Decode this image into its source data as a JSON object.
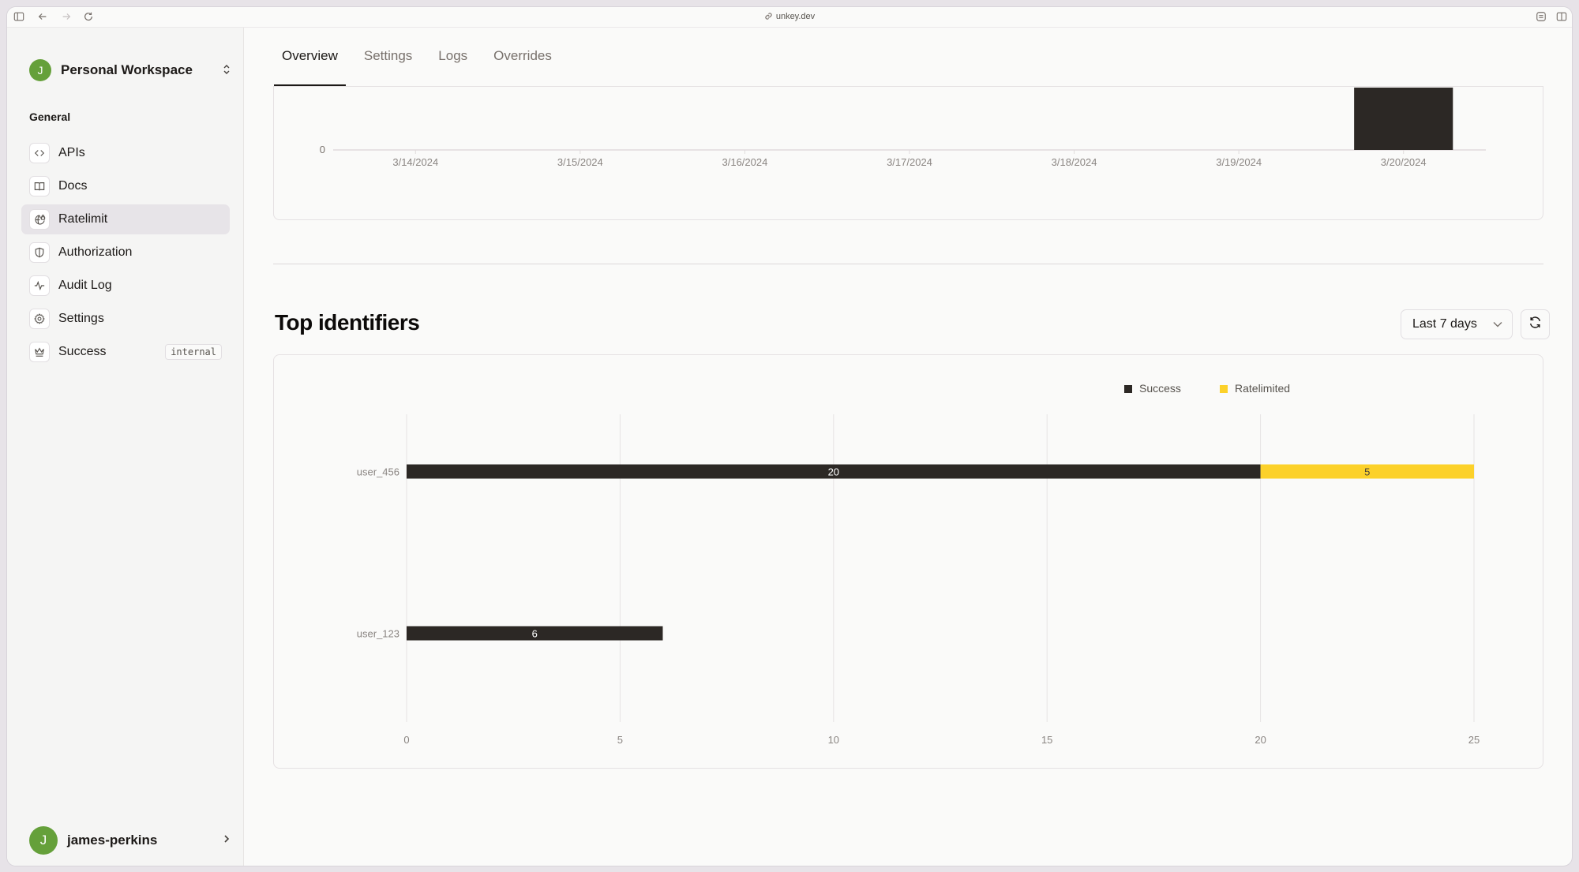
{
  "browser": {
    "url": "unkey.dev"
  },
  "sidebar": {
    "workspace": {
      "avatar_initial": "J",
      "name": "Personal Workspace"
    },
    "group_label": "General",
    "items": [
      {
        "label": "APIs",
        "icon": "code-icon",
        "active": false
      },
      {
        "label": "Docs",
        "icon": "book-icon",
        "active": false
      },
      {
        "label": "Ratelimit",
        "icon": "globe-lock-icon",
        "active": true
      },
      {
        "label": "Authorization",
        "icon": "shield-icon",
        "active": false
      },
      {
        "label": "Audit Log",
        "icon": "activity-icon",
        "active": false
      },
      {
        "label": "Settings",
        "icon": "gear-icon",
        "active": false
      },
      {
        "label": "Success",
        "icon": "crown-icon",
        "active": false,
        "badge": "internal"
      }
    ],
    "user": {
      "avatar_initial": "J",
      "name": "james-perkins"
    }
  },
  "tabs": [
    {
      "label": "Overview",
      "active": true
    },
    {
      "label": "Settings",
      "active": false
    },
    {
      "label": "Logs",
      "active": false
    },
    {
      "label": "Overrides",
      "active": false
    }
  ],
  "top_identifiers": {
    "title": "Top identifiers",
    "range_label": "Last 7 days"
  },
  "colors": {
    "success": "#2c2825",
    "ratelimited": "#fcd12a"
  },
  "chart_data": [
    {
      "type": "bar",
      "title": "",
      "categories": [
        "3/14/2024",
        "3/15/2024",
        "3/16/2024",
        "3/17/2024",
        "3/18/2024",
        "3/19/2024",
        "3/20/2024"
      ],
      "values": [
        0,
        0,
        0,
        0,
        0,
        0,
        25
      ],
      "y_tick_labels_visible": [
        "0"
      ],
      "note": "chart scrolled; only bottom portion visible",
      "xlabel": "",
      "ylabel": ""
    },
    {
      "type": "bar",
      "orientation": "horizontal",
      "stacked": true,
      "categories": [
        "user_456",
        "user_123"
      ],
      "series": [
        {
          "name": "Success",
          "values": [
            20,
            6
          ]
        },
        {
          "name": "Ratelimited",
          "values": [
            5,
            0
          ]
        }
      ],
      "x_ticks": [
        0,
        5,
        10,
        15,
        20,
        25
      ],
      "xlim": [
        0,
        25
      ],
      "grid": true,
      "legend": "top-right",
      "xlabel": "",
      "ylabel": ""
    }
  ]
}
